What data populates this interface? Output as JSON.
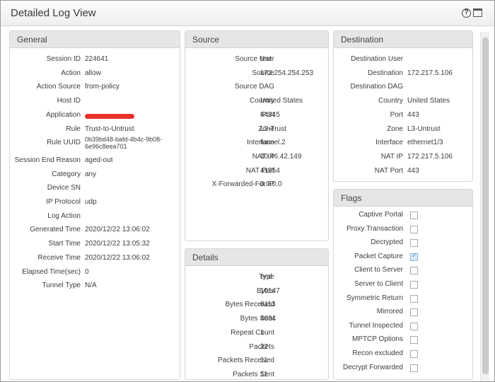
{
  "window": {
    "title": "Detailed Log View",
    "help_glyph": "?"
  },
  "general": {
    "header": "General",
    "rows": [
      {
        "label": "Session ID",
        "value": "224641"
      },
      {
        "label": "Action",
        "value": "allow"
      },
      {
        "label": "Action Source",
        "value": "from-policy"
      },
      {
        "label": "Host ID",
        "value": ""
      },
      {
        "label": "Application",
        "value": "",
        "redacted": true
      },
      {
        "label": "Rule",
        "value": "Trust-to-Untrust"
      },
      {
        "label": "Rule UUID",
        "value": "0b39bd48-bafd-4b4c-9b08-6e96c8eea701"
      },
      {
        "label": "Session End Reason",
        "value": "aged-out"
      },
      {
        "label": "Category",
        "value": "any"
      },
      {
        "label": "Device SN",
        "value": ""
      },
      {
        "label": "IP Protocol",
        "value": "udp"
      },
      {
        "label": "Log Action",
        "value": ""
      },
      {
        "label": "Generated Time",
        "value": "2020/12/22 13:06:02"
      },
      {
        "label": "Start Time",
        "value": "2020/12/22 13:05:32"
      },
      {
        "label": "Receive Time",
        "value": "2020/12/22 13:06:02"
      },
      {
        "label": "Elapsed Time(sec)",
        "value": "0"
      },
      {
        "label": "Tunnel Type",
        "value": "N/A"
      }
    ]
  },
  "source": {
    "header": "Source",
    "rows": [
      {
        "label": "Source User",
        "value": "test"
      },
      {
        "label": "Source",
        "value": "172.254.254.253"
      },
      {
        "label": "Source DAG",
        "value": ""
      },
      {
        "label": "Country",
        "value": "United States"
      },
      {
        "label": "Port",
        "value": "64345"
      },
      {
        "label": "Zone",
        "value": "L3-Trust"
      },
      {
        "label": "Interface",
        "value": "tunnel.2"
      },
      {
        "label": "NAT IP",
        "value": "10.46.42.149"
      },
      {
        "label": "NAT Port",
        "value": "41854"
      },
      {
        "label": "X-Forwarded-For IP",
        "value": "0.0.0.0"
      }
    ]
  },
  "destination": {
    "header": "Destination",
    "rows": [
      {
        "label": "Destination User",
        "value": ""
      },
      {
        "label": "Destination",
        "value": "172.217.5.106"
      },
      {
        "label": "Destination DAG",
        "value": ""
      },
      {
        "label": "Country",
        "value": "United States"
      },
      {
        "label": "Port",
        "value": "443"
      },
      {
        "label": "Zone",
        "value": "L3-Untrust"
      },
      {
        "label": "Interface",
        "value": "ethernet1/3"
      },
      {
        "label": "NAT IP",
        "value": "172.217.5.106"
      },
      {
        "label": "NAT Port",
        "value": "443"
      }
    ]
  },
  "details": {
    "header": "Details",
    "rows": [
      {
        "label": "Type",
        "value": "end"
      },
      {
        "label": "Bytes",
        "value": "10147"
      },
      {
        "label": "Bytes Received",
        "value": "6113"
      },
      {
        "label": "Bytes Sent",
        "value": "4034"
      },
      {
        "label": "Repeat Count",
        "value": "1"
      },
      {
        "label": "Packets",
        "value": "22"
      },
      {
        "label": "Packets Received",
        "value": "11"
      },
      {
        "label": "Packets Sent",
        "value": "11"
      }
    ]
  },
  "flags": {
    "header": "Flags",
    "rows": [
      {
        "label": "Captive Portal",
        "checked": false
      },
      {
        "label": "Proxy Transaction",
        "checked": false
      },
      {
        "label": "Decrypted",
        "checked": false
      },
      {
        "label": "Packet Capture",
        "checked": true
      },
      {
        "label": "Client to Server",
        "checked": false
      },
      {
        "label": "Server to Client",
        "checked": false
      },
      {
        "label": "Symmetric Return",
        "checked": false
      },
      {
        "label": "Mirrored",
        "checked": false
      },
      {
        "label": "Tunnel Inspected",
        "checked": false
      },
      {
        "label": "MPTCP Options",
        "checked": false
      },
      {
        "label": "Recon excluded",
        "checked": false
      },
      {
        "label": "Decrypt Forwarded",
        "checked": false
      }
    ]
  }
}
